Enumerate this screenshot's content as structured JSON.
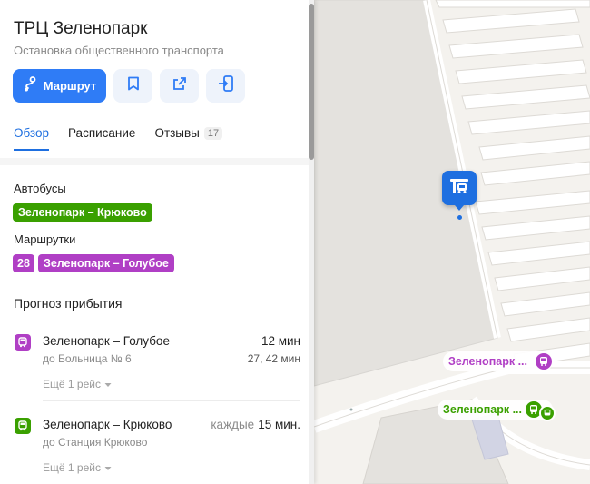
{
  "header": {
    "title": "ТРЦ Зеленопарк",
    "subtitle": "Остановка общественного транспорта"
  },
  "actions": {
    "route_label": "Маршрут",
    "icons": [
      "route-icon",
      "bookmark-icon",
      "share-icon",
      "send-to-phone-icon"
    ]
  },
  "tabs": [
    {
      "label": "Обзор",
      "active": true
    },
    {
      "label": "Расписание",
      "active": false
    },
    {
      "label": "Отзывы",
      "active": false,
      "count": "17"
    }
  ],
  "transport": {
    "buses_label": "Автобусы",
    "bus_routes": [
      "Зеленопарк – Крюково"
    ],
    "minibus_label": "Маршрутки",
    "minibus_number": "28",
    "minibus_routes": [
      "Зеленопарк – Голубое"
    ]
  },
  "forecast": {
    "title": "Прогноз прибытия",
    "arrivals": [
      {
        "name": "Зеленопарк – Голубое",
        "destination": "до Больница № 6",
        "prefix": "",
        "time": "12 мин",
        "next": "27, 42 мин",
        "more": "Ещё 1 рейс",
        "color": "#b03fc5",
        "icon": "minibus-icon"
      },
      {
        "name": "Зеленопарк – Крюково",
        "destination": "до Станция Крюково",
        "prefix": "каждые",
        "time": "15 мин.",
        "next": "",
        "more": "Ещё 1 рейс",
        "color": "#3aa000",
        "icon": "bus-icon"
      }
    ]
  },
  "map": {
    "labels": [
      {
        "text": "Зеленопарк ...",
        "color": "#b03fc5"
      },
      {
        "text": "Зеленопарк ...",
        "color": "#3aa000"
      }
    ],
    "pin_icon": "bus-stop-icon",
    "accent": "#1e6fe0"
  }
}
